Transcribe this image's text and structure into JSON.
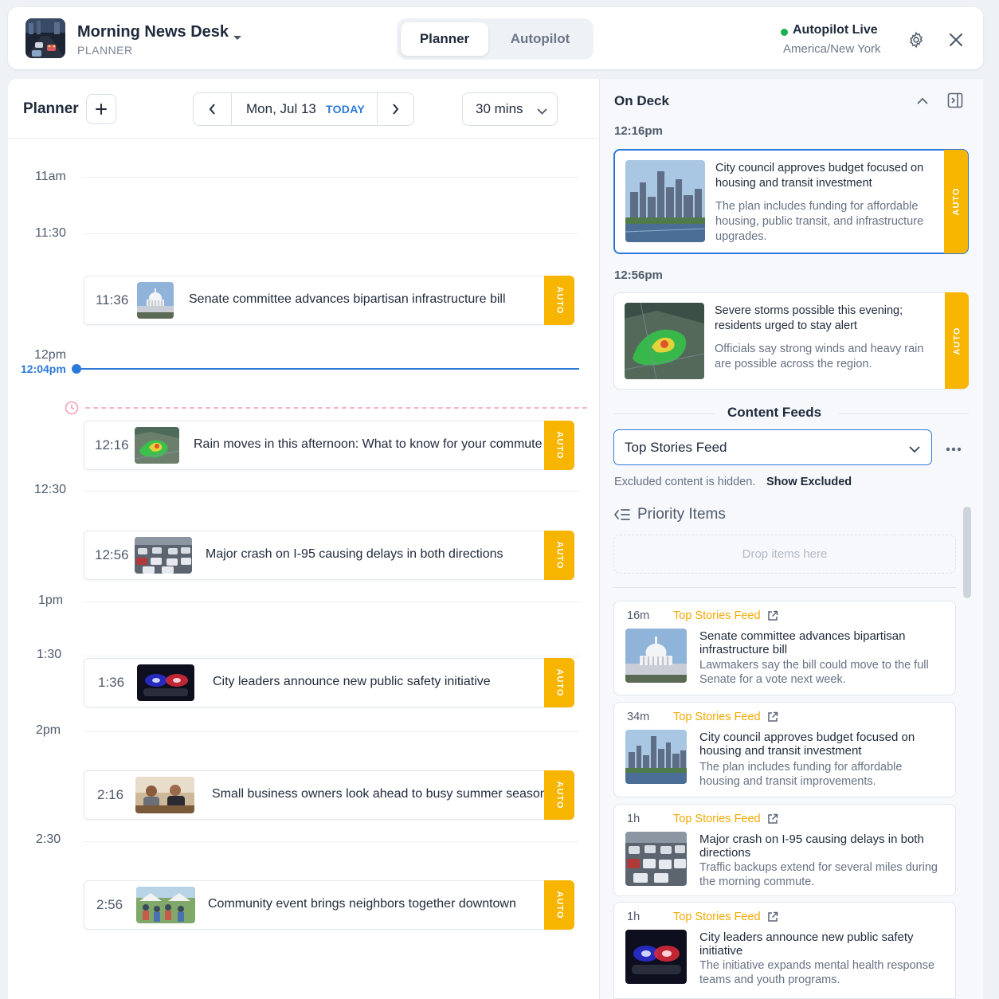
{
  "header": {
    "app_title": "Morning News Desk",
    "app_subtitle": "PLANNER",
    "tabs": [
      {
        "label": "Planner",
        "active": true
      },
      {
        "label": "Autopilot",
        "active": false
      }
    ],
    "status_label": "Autopilot Live",
    "status_color": "#18b04a",
    "timezone": "America/New York",
    "icons": [
      "gear-icon",
      "close-icon"
    ]
  },
  "planner": {
    "title": "Planner",
    "date": "Mon, Jul 13",
    "today_label": "TODAY",
    "interval": "30 mins",
    "now_label": "12:04pm",
    "time_labels": [
      "11am",
      "11:30",
      "12pm",
      "12:30",
      "1pm",
      "1:30",
      "2pm",
      "2:30"
    ],
    "events": [
      {
        "time": "11:36",
        "title": "Senate committee advances bipartisan infrastructure bill",
        "tag": "AUTO",
        "thumb": "capitol"
      },
      {
        "time": "12:16",
        "title": "Rain moves in this afternoon: What to know for your commute",
        "tag": "AUTO",
        "thumb": "radar"
      },
      {
        "time": "12:56",
        "title": "Major crash on I-95 causing delays in both directions",
        "tag": "AUTO",
        "thumb": "traffic"
      },
      {
        "time": "1:36",
        "title": "City leaders announce new public safety initiative",
        "tag": "AUTO",
        "thumb": "police"
      },
      {
        "time": "2:16",
        "title": "Small business owners look ahead to busy summer season",
        "tag": "AUTO",
        "thumb": "business"
      },
      {
        "time": "2:56",
        "title": "Community event brings neighbors together downtown",
        "tag": "AUTO",
        "thumb": "community"
      }
    ]
  },
  "on_deck": {
    "title": "On Deck",
    "items": [
      {
        "time": "12:16pm",
        "title": "City council approves budget focused on housing and transit investment",
        "description": "The plan includes funding for affordable housing, public transit, and infrastructure upgrades.",
        "tag": "AUTO",
        "thumb": "city"
      },
      {
        "time": "12:56pm",
        "title": "Severe storms possible this evening; residents urged to stay alert",
        "description": "Officials say strong winds and heavy rain are possible across the region.",
        "tag": "AUTO",
        "thumb": "radar"
      }
    ]
  },
  "content_feeds": {
    "title": "Content Feeds",
    "selected_feed": "Top Stories Feed",
    "excluded_note": "Excluded content is hidden.",
    "show_excluded": "Show Excluded",
    "priority_title": "Priority Items",
    "drop_placeholder": "Drop items here",
    "items": [
      {
        "age": "16m",
        "source": "Top Stories Feed",
        "title": "Senate committee advances bipartisan infrastructure bill",
        "description": "Lawmakers say the bill could move to the full Senate for a vote next week.",
        "thumb": "capitol"
      },
      {
        "age": "34m",
        "source": "Top Stories Feed",
        "title": "City council approves budget focused on housing and transit investment",
        "description": "The plan includes funding for affordable housing and transit improvements.",
        "thumb": "city"
      },
      {
        "age": "1h",
        "source": "Top Stories Feed",
        "title": "Major crash on I-95 causing delays in both directions",
        "description": "Traffic backups extend for several miles during the morning commute.",
        "thumb": "traffic"
      },
      {
        "age": "1h",
        "source": "Top Stories Feed",
        "title": "City leaders announce new public safety initiative",
        "description": "The initiative expands mental health response teams and youth programs.",
        "thumb": "police"
      }
    ]
  },
  "colors": {
    "accent": "#2b7ad9",
    "auto_tag": "#f7b500",
    "feed_source": "#f2a900",
    "now_line": "#2b7ad9"
  }
}
